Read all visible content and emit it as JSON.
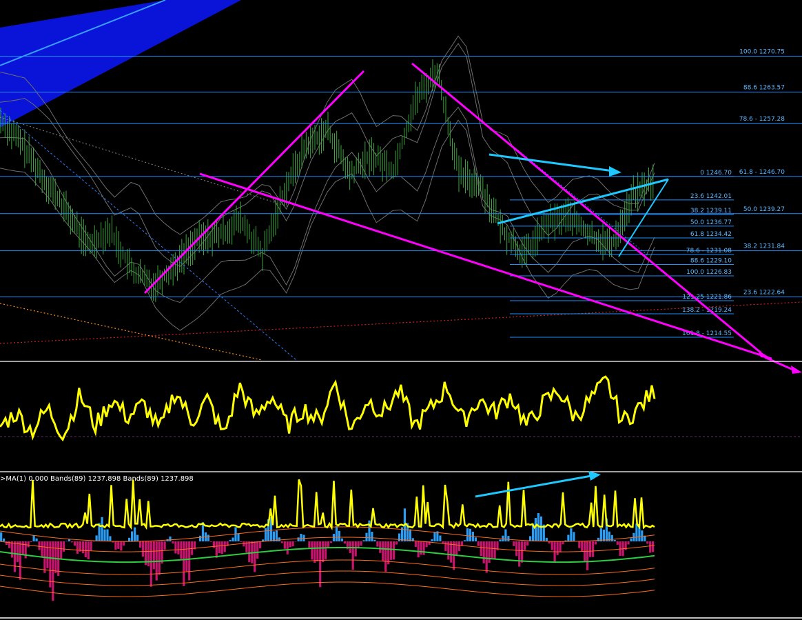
{
  "colors": {
    "background": "#000000",
    "fib_line": "#1e90ff",
    "fib_text": "#5fb8ff",
    "trendline_magenta": "#ff00ff",
    "trendline_cyan": "#1ec8ff",
    "candles": "#3aa63a",
    "envelope": "#6e6e6e",
    "channel_fill": "#0a14d8",
    "oscillator": "#ffff00",
    "histogram_pos": "#2a9df4",
    "histogram_neg": "#c8146e",
    "ma_green": "#2ecc40",
    "bands_orange": "#ff6a1a",
    "separator": "#ffffff"
  },
  "chart_data": [
    {
      "type": "line",
      "panel": "price",
      "description_series": [
        {
          "name": "close",
          "x": [
            0,
            5,
            10,
            15,
            20,
            25,
            30,
            35,
            40,
            45,
            50,
            55,
            60,
            65,
            70,
            75,
            80,
            85,
            90,
            95,
            100,
            105,
            110,
            115,
            120,
            125,
            130,
            135,
            140,
            145,
            150
          ],
          "values": [
            1258,
            1253,
            1246,
            1240,
            1233,
            1236,
            1228,
            1225,
            1229,
            1234,
            1235,
            1238,
            1231,
            1244,
            1253,
            1256,
            1247,
            1251,
            1248,
            1262,
            1268,
            1247,
            1245,
            1236,
            1231,
            1237,
            1239,
            1235,
            1233,
            1243,
            1246
          ]
        }
      ],
      "fib_levels_right": [
        {
          "label": "100.0 1270.75",
          "value": 1270.75
        },
        {
          "label": "88.6 1263.57",
          "value": 1263.57
        },
        {
          "label": "78.6 - 1257.28",
          "value": 1257.28
        },
        {
          "label": "61.8 - 1246.70",
          "value": 1246.7
        },
        {
          "label": "50.0 1239.27",
          "value": 1239.27
        },
        {
          "label": "38.2 1231.84",
          "value": 1231.84
        },
        {
          "label": "23.6 1222.64",
          "value": 1222.64
        }
      ],
      "fib_levels_inner": [
        {
          "label": "0 1246.70",
          "value": 1246.7
        },
        {
          "label": "23.6 1242.01",
          "value": 1242.01
        },
        {
          "label": "38.2 1239.11",
          "value": 1239.11
        },
        {
          "label": "50.0 1236.77",
          "value": 1236.77
        },
        {
          "label": "61.8 1234.42",
          "value": 1234.42
        },
        {
          "label": "78.6 - 1231.08",
          "value": 1231.08
        },
        {
          "label": "88.6 1229.10",
          "value": 1229.1
        },
        {
          "label": "100.0 1226.83",
          "value": 1226.83
        },
        {
          "label": "121.25 1221.86",
          "value": 1221.86
        },
        {
          "label": "138.2 - 1219.24",
          "value": 1219.24
        },
        {
          "label": "161.8 - 1214.55",
          "value": 1214.55
        }
      ],
      "ylim": [
        1210,
        1282
      ]
    },
    {
      "type": "line",
      "panel": "oscillator",
      "series": [
        {
          "values": [
            40,
            55,
            35,
            60,
            30,
            75,
            40,
            70,
            50,
            65,
            35,
            80,
            45,
            70,
            30,
            85,
            50,
            75,
            40,
            60,
            45,
            90,
            35,
            70,
            55,
            80,
            40,
            60,
            85,
            45,
            70,
            55,
            75,
            40,
            65,
            80,
            50,
            70,
            90,
            45,
            60,
            80
          ]
        }
      ],
      "ylim": [
        0,
        100
      ]
    },
    {
      "type": "bar",
      "panel": "histogram",
      "header": ">MA(1) 0.000  Bands(89) 1237.898  Bands(89) 1237.898",
      "series": [
        {
          "values": [
            20,
            -60,
            15,
            -80,
            10,
            -40,
            35,
            -20,
            25,
            -90,
            15,
            -70,
            30,
            -30,
            20,
            -50,
            40,
            -20,
            15,
            -60,
            25,
            -40,
            30,
            -70,
            45,
            -30,
            20,
            -50,
            35,
            -60,
            25,
            -40,
            50,
            -30,
            20,
            -45,
            40,
            -25,
            30,
            -35
          ]
        }
      ],
      "ylim": [
        -100,
        60
      ]
    }
  ]
}
